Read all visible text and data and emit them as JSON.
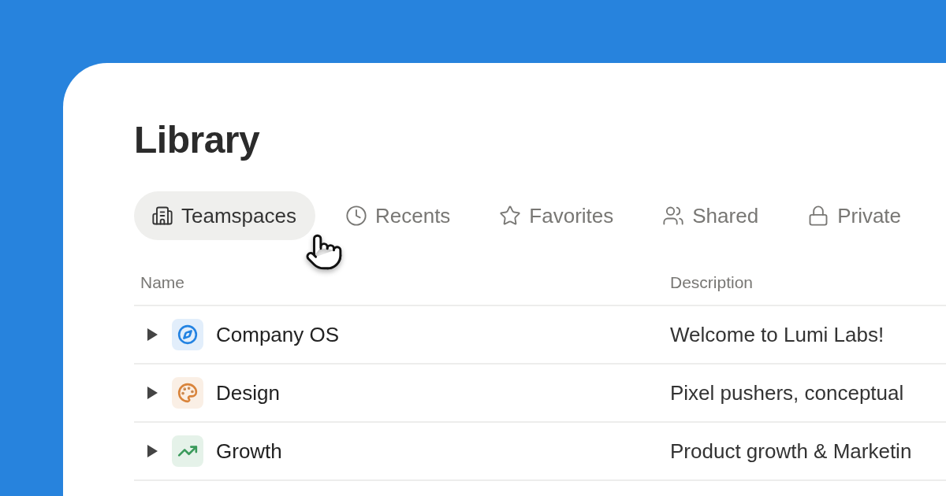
{
  "title": "Library",
  "tabs": [
    {
      "label": "Teamspaces",
      "kind": "building",
      "selected": true
    },
    {
      "label": "Recents",
      "kind": "clock",
      "selected": false
    },
    {
      "label": "Favorites",
      "kind": "star",
      "selected": false
    },
    {
      "label": "Shared",
      "kind": "users",
      "selected": false
    },
    {
      "label": "Private",
      "kind": "lock",
      "selected": false
    }
  ],
  "table": {
    "columns": [
      "Name",
      "Description"
    ],
    "rows": [
      {
        "name": "Company OS",
        "kind": "compass",
        "color": "#2383e2",
        "description": "Welcome to Lumi Labs!",
        "expanded": false
      },
      {
        "name": "Design",
        "kind": "palette",
        "color": "#d9843b",
        "description": "Pixel pushers, conceptual",
        "expanded": false
      },
      {
        "name": "Growth",
        "kind": "trend",
        "color": "#3a9a5b",
        "description": "Product growth & Marketin",
        "expanded": false
      }
    ]
  }
}
